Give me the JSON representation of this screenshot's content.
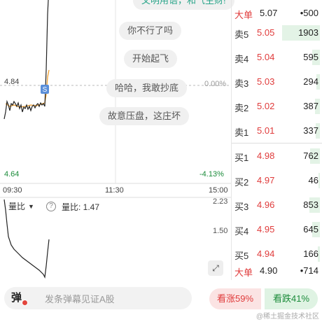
{
  "colors": {
    "up": "#e03b3b",
    "down": "#1c8c3b",
    "grid": "#bbbbbb",
    "price_line": "#222222",
    "avg_line": "#f0a030",
    "marker": "#5b8fd9"
  },
  "danmu": {
    "partial": "文明用语，和气生财!",
    "items": [
      "你不行了吗",
      "开始起飞",
      "哈哈，我敢抄底",
      "故意压盘，这庄坏"
    ]
  },
  "price_axis": {
    "ref_price": "4.84",
    "ref_pct": "0.00%",
    "low_price": "4.64",
    "low_pct": "-4.13%"
  },
  "time_axis": {
    "start": "09:30",
    "mid": "11:30",
    "end": "15:00"
  },
  "volume_panel": {
    "indicator": "量比",
    "indicator_value": "量比: 1.47",
    "help": "?",
    "axis_top": "2.23",
    "axis_mid": "1.50",
    "expand": "⤢"
  },
  "marker_label": "S",
  "order_book": {
    "big_top": {
      "label": "大单",
      "price": "5.07",
      "value": "•500"
    },
    "asks": [
      {
        "label": "卖5",
        "price": "5.05",
        "volume": "1903",
        "fill": 1.0
      },
      {
        "label": "卖4",
        "price": "5.04",
        "volume": "595",
        "fill": 0.2
      },
      {
        "label": "卖3",
        "price": "5.03",
        "volume": "294",
        "fill": 0.1
      },
      {
        "label": "卖2",
        "price": "5.02",
        "volume": "387",
        "fill": 0.13
      },
      {
        "label": "卖1",
        "price": "5.01",
        "volume": "337",
        "fill": 0.12
      }
    ],
    "bids": [
      {
        "label": "买1",
        "price": "4.98",
        "volume": "762",
        "fill": 0.25
      },
      {
        "label": "买2",
        "price": "4.97",
        "volume": "46",
        "fill": 0.02
      },
      {
        "label": "买3",
        "price": "4.96",
        "volume": "853",
        "fill": 0.28
      },
      {
        "label": "买4",
        "price": "4.95",
        "volume": "645",
        "fill": 0.21
      },
      {
        "label": "买5",
        "price": "4.94",
        "volume": "166",
        "fill": 0.06
      }
    ],
    "big_bottom": {
      "label": "大单",
      "price": "4.90",
      "value": "•714"
    }
  },
  "bottom_bar": {
    "danmu_toggle": "弹",
    "danmu_placeholder": "发条弹幕见证A股",
    "vote_up": "看涨59%",
    "vote_down": "看跌41%"
  },
  "watermark": "@稀土掘金技术社区"
}
